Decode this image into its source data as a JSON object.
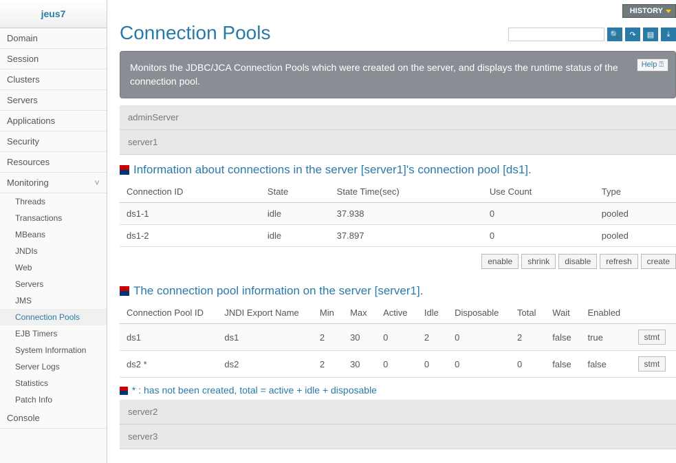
{
  "sidebar": {
    "brand": "jeus7",
    "items": [
      "Domain",
      "Session",
      "Clusters",
      "Servers",
      "Applications",
      "Security",
      "Resources",
      "Monitoring"
    ],
    "sub": [
      "Threads",
      "Transactions",
      "MBeans",
      "JNDIs",
      "Web",
      "Servers",
      "JMS",
      "Connection Pools",
      "EJB Timers",
      "System Information",
      "Server Logs",
      "Statistics",
      "Patch Info"
    ],
    "console": "Console"
  },
  "page": {
    "title": "Connection Pools",
    "history": "HISTORY",
    "desc": "Monitors the JDBC/JCA Connection Pools which were created on the server, and displays the runtime status of the connection pool.",
    "help": "Help",
    "search_ph": ""
  },
  "servers_top": [
    "adminServer",
    "server1"
  ],
  "section1": {
    "title": "Information about connections in the server [server1]'s connection pool [ds1].",
    "cols": [
      "Connection ID",
      "State",
      "State Time(sec)",
      "Use Count",
      "Type"
    ],
    "rows": [
      [
        "ds1-1",
        "idle",
        "37.938",
        "0",
        "pooled"
      ],
      [
        "ds1-2",
        "idle",
        "37.897",
        "0",
        "pooled"
      ]
    ]
  },
  "buttons": [
    "enable",
    "shrink",
    "disable",
    "refresh",
    "create"
  ],
  "section2": {
    "title": "The connection pool information on the server [server1].",
    "cols": [
      "Connection Pool ID",
      "JNDI Export Name",
      "Min",
      "Max",
      "Active",
      "Idle",
      "Disposable",
      "Total",
      "Wait",
      "Enabled",
      ""
    ],
    "rows": [
      [
        "ds1",
        "ds1",
        "2",
        "30",
        "0",
        "2",
        "0",
        "2",
        "false",
        "true",
        "stmt"
      ],
      [
        "ds2 *",
        "ds2",
        "2",
        "30",
        "0",
        "0",
        "0",
        "0",
        "false",
        "false",
        "stmt"
      ]
    ]
  },
  "footnote": "* : has not been created, total = active + idle + disposable",
  "servers_bottom": [
    "server2",
    "server3"
  ]
}
